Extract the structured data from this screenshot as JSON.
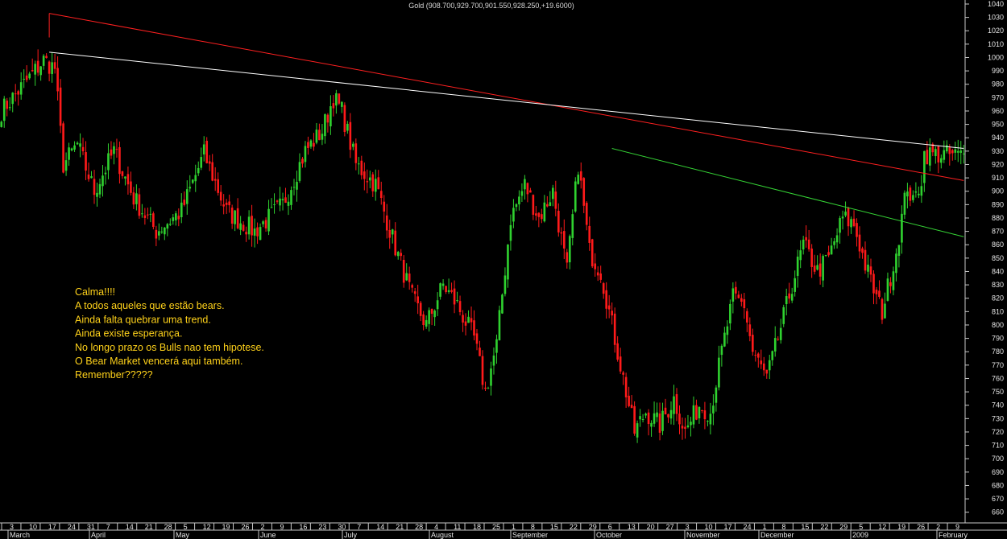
{
  "chart_data": {
    "type": "candlestick",
    "title": "Gold (908.700,929.700,901.550,928.250,+19.6000)",
    "ylim": [
      652,
      1043
    ],
    "y_ticks": [
      1040,
      1030,
      1020,
      1010,
      1000,
      990,
      980,
      970,
      960,
      950,
      940,
      930,
      920,
      910,
      900,
      890,
      880,
      870,
      860,
      850,
      840,
      830,
      820,
      810,
      800,
      790,
      780,
      770,
      760,
      750,
      740,
      730,
      720,
      710,
      700,
      690,
      680,
      670,
      660
    ],
    "x_day_ticks": [
      "3",
      "10",
      "17",
      "24",
      "31",
      "7",
      "14",
      "21",
      "28",
      "5",
      "12",
      "19",
      "26",
      "2",
      "9",
      "16",
      "23",
      "30",
      "7",
      "14",
      "21",
      "28",
      "4",
      "11",
      "18",
      "25",
      "1",
      "8",
      "15",
      "22",
      "29",
      "6",
      "13",
      "20",
      "27",
      "3",
      "10",
      "17",
      "24",
      "1",
      "8",
      "15",
      "22",
      "29",
      "5",
      "12",
      "19",
      "26",
      "2",
      "9"
    ],
    "x_month_ticks": [
      "March",
      "April",
      "May",
      "June",
      "July",
      "August",
      "September",
      "October",
      "November",
      "December",
      "2009",
      "February"
    ],
    "up_color": "#2fd12f",
    "down_color": "#ff1a1a",
    "keypoints": [
      {
        "i": 0,
        "close": 960
      },
      {
        "i": 10,
        "close": 985
      },
      {
        "i": 15,
        "close": 998
      },
      {
        "i": 19,
        "close": 992
      },
      {
        "i": 22,
        "close": 920
      },
      {
        "i": 27,
        "close": 935
      },
      {
        "i": 33,
        "close": 900
      },
      {
        "i": 40,
        "close": 930
      },
      {
        "i": 47,
        "close": 895
      },
      {
        "i": 55,
        "close": 870
      },
      {
        "i": 64,
        "close": 885
      },
      {
        "i": 72,
        "close": 928
      },
      {
        "i": 80,
        "close": 885
      },
      {
        "i": 90,
        "close": 870
      },
      {
        "i": 100,
        "close": 890
      },
      {
        "i": 108,
        "close": 930
      },
      {
        "i": 114,
        "close": 945
      },
      {
        "i": 118,
        "close": 970
      },
      {
        "i": 121,
        "close": 960
      },
      {
        "i": 126,
        "close": 920
      },
      {
        "i": 133,
        "close": 905
      },
      {
        "i": 140,
        "close": 858
      },
      {
        "i": 146,
        "close": 820
      },
      {
        "i": 151,
        "close": 800
      },
      {
        "i": 157,
        "close": 830
      },
      {
        "i": 162,
        "close": 815
      },
      {
        "i": 168,
        "close": 790
      },
      {
        "i": 172,
        "close": 750
      },
      {
        "i": 176,
        "close": 785
      },
      {
        "i": 181,
        "close": 880
      },
      {
        "i": 186,
        "close": 905
      },
      {
        "i": 191,
        "close": 880
      },
      {
        "i": 196,
        "close": 900
      },
      {
        "i": 201,
        "close": 840
      },
      {
        "i": 205,
        "close": 920
      },
      {
        "i": 209,
        "close": 855
      },
      {
        "i": 213,
        "close": 840
      },
      {
        "i": 218,
        "close": 790
      },
      {
        "i": 222,
        "close": 750
      },
      {
        "i": 225,
        "close": 720
      },
      {
        "i": 229,
        "close": 735
      },
      {
        "i": 234,
        "close": 725
      },
      {
        "i": 239,
        "close": 745
      },
      {
        "i": 243,
        "close": 720
      },
      {
        "i": 248,
        "close": 740
      },
      {
        "i": 252,
        "close": 735
      },
      {
        "i": 256,
        "close": 780
      },
      {
        "i": 260,
        "close": 820
      },
      {
        "i": 264,
        "close": 815
      },
      {
        "i": 267,
        "close": 780
      },
      {
        "i": 272,
        "close": 760
      },
      {
        "i": 276,
        "close": 790
      },
      {
        "i": 281,
        "close": 830
      },
      {
        "i": 285,
        "close": 860
      },
      {
        "i": 290,
        "close": 840
      },
      {
        "i": 294,
        "close": 850
      },
      {
        "i": 299,
        "close": 880
      },
      {
        "i": 303,
        "close": 875
      },
      {
        "i": 307,
        "close": 845
      },
      {
        "i": 311,
        "close": 820
      },
      {
        "i": 313,
        "close": 810
      },
      {
        "i": 318,
        "close": 855
      },
      {
        "i": 322,
        "close": 905
      },
      {
        "i": 324,
        "close": 890
      },
      {
        "i": 327,
        "close": 910
      },
      {
        "i": 328,
        "close": 928
      }
    ],
    "trendlines": [
      {
        "color": "#ff2020",
        "from": {
          "i": 17,
          "v": 1033
        },
        "to": {
          "i": 342,
          "v": 908
        }
      },
      {
        "color": "#ffffff",
        "from": {
          "i": 17,
          "v": 1004
        },
        "to": {
          "i": 342,
          "v": 932
        }
      },
      {
        "color": "#35d435",
        "from": {
          "i": 217,
          "v": 932
        },
        "to": {
          "i": 342,
          "v": 866
        }
      }
    ],
    "annotation_lines": [
      "Calma!!!!",
      "A todos aqueles que estão bears.",
      "Ainda falta quebrar uma trend.",
      "Ainda existe esperança.",
      "No longo prazo os Bulls nao tem hipotese.",
      "O Bear Market vencerá aqui também.",
      "Remember?????"
    ],
    "annotation_color": "#ffd21a"
  }
}
